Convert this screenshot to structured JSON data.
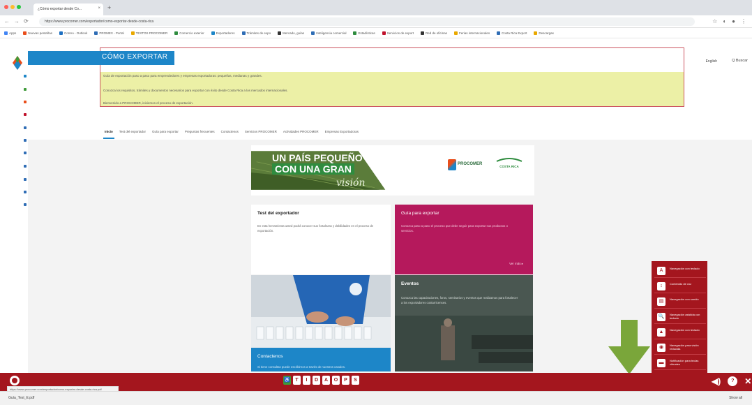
{
  "browser": {
    "tab_title": "¿Cómo exportar desde Co...",
    "tab_close": "×",
    "new_tab": "+",
    "url": "https://www.procomer.com/exportador/como-exportar-desde-costa-rica",
    "nav_back": "←",
    "nav_forward": "→",
    "nav_reload": "⟳",
    "ext_icons": [
      "☆",
      "◐",
      "●",
      "⋮"
    ],
    "bookmarks": [
      {
        "label": "Apps",
        "color": "#4285f4"
      },
      {
        "label": "Nuevas pestañas",
        "color": "#e94e1b"
      },
      {
        "label": "Correo - Outlook",
        "color": "#1d6fc1"
      },
      {
        "label": "PROMEX - Portal",
        "color": "#2f6db5"
      },
      {
        "label": "TEXTOS PROCOMER",
        "color": "#e9a800"
      },
      {
        "label": "Comercio exterior",
        "color": "#2f8c3f"
      },
      {
        "label": "Exportadores",
        "color": "#1d86c8"
      },
      {
        "label": "Trámites de expo",
        "color": "#2f6db5"
      },
      {
        "label": "Mercado, guías",
        "color": "#333333"
      },
      {
        "label": "Inteligencia comercial",
        "color": "#2f6db5"
      },
      {
        "label": "Estadísticas",
        "color": "#2f8c3f"
      },
      {
        "label": "Servicios de export",
        "color": "#c0122c"
      },
      {
        "label": "Red de oficinas",
        "color": "#333333"
      },
      {
        "label": "Ferias internacionales",
        "color": "#e9a800"
      },
      {
        "label": "Costa Rica Export",
        "color": "#2f6db5"
      },
      {
        "label": "Descargas",
        "color": "#e9a800"
      }
    ]
  },
  "header": {
    "title": "CÓMO EXPORTAR",
    "language": "English",
    "search": "Q Buscar",
    "lines": [
      "Guía de exportación paso a paso para emprendedores y empresas exportadoras: pequeñas, medianas y grandes.",
      "Conozca los requisitos, trámites y documentos necesarios para exportar con éxito desde Costa Rica a los mercados internacionales.",
      "Bienvenido a PROCOMER, iniciemos el proceso de exportación."
    ]
  },
  "nav": {
    "items": [
      "Inicio",
      "Test del exportador",
      "Guía para exportar",
      "Preguntas frecuentes",
      "Contactenos",
      "Servicios PROCOMER",
      "Actividades PROCOMER",
      "Empresas Exportadoras"
    ]
  },
  "banner": {
    "line1": "UN PAÍS PEQUEÑO",
    "line2": "CON UNA GRAN",
    "line3": "visión",
    "procomer": "PROCOMER",
    "costa_rica": "COSTA RICA"
  },
  "cards": {
    "test": {
      "title": "Test del exportador",
      "text": "En esta herramienta usted podrá conocer sus fortalezas y debilidades en el proceso de exportación."
    },
    "guide": {
      "title": "Guía para exportar",
      "text": "Conozca paso a paso el proceso que debe seguir para exportar sus productos o servicios.",
      "link": "Ver más ▸"
    },
    "events": {
      "title": "Eventos",
      "text": "Conozca las capacitaciones, foros, seminarios y eventos que realizamos para fortalecer a los exportadores costarricenses."
    },
    "contact": {
      "title": "Contactenos",
      "text": "Si tiene consultas puede escribirnos a través de nuestros canales."
    }
  },
  "accessibility": {
    "tools": [
      "♿",
      "T",
      "I",
      "D",
      "A",
      "O",
      "P",
      "S"
    ],
    "right_icons": [
      "◀)",
      "?",
      "✕"
    ],
    "menu": [
      {
        "icon": "A",
        "label": "Navegación con teclado"
      },
      {
        "icon": "↕",
        "label": "Contenido de voz"
      },
      {
        "icon": "▤",
        "label": "Navegación con sonido"
      },
      {
        "icon": "🔍",
        "label": "Navegación asistida con teclado"
      },
      {
        "icon": "▲",
        "label": "Navegación con teclado"
      },
      {
        "icon": "◉",
        "label": "Navegación para visión reducida"
      },
      {
        "icon": "▬",
        "label": "Notificación para teclas virtuales"
      },
      {
        "icon": "▤",
        "label": "Navegación con sonido"
      }
    ]
  },
  "status": {
    "tooltip": "https://www.procomer.com/exportador/como-exportar-desde-costa-rica.pdf",
    "download_file": "Guía_Test_E.pdf",
    "download_all": "Show all"
  },
  "colors": {
    "accent_blue": "#1d86c8",
    "pink": "#b5195c",
    "accessibility_red": "#a4161e",
    "arrow_green": "#7aa63a",
    "highlight_yellow": "#ecf0a6"
  }
}
